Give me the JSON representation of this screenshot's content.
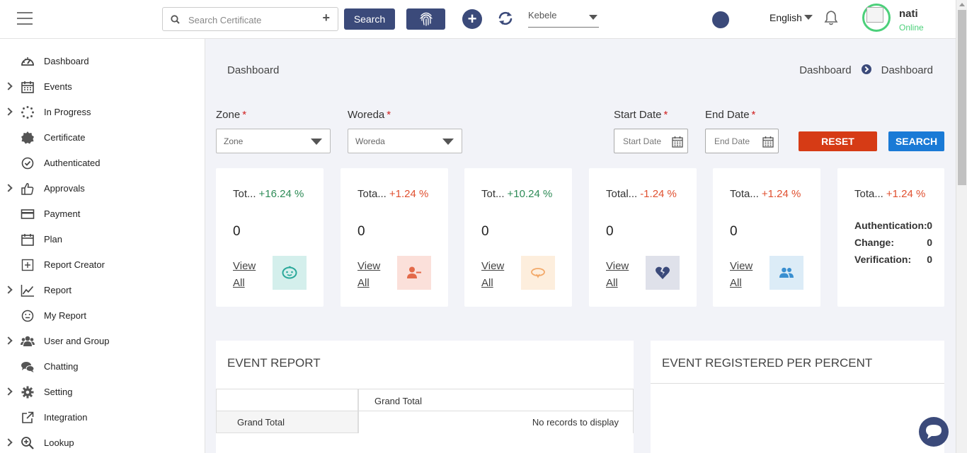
{
  "topbar": {
    "search_placeholder": "Search Certificate",
    "search_button": "Search",
    "kebele": "Kebele",
    "language": "English",
    "user": {
      "name": "nati",
      "status": "Online"
    }
  },
  "sidebar": {
    "items": [
      {
        "label": "Dashboard",
        "icon": "dashboard-gauge-icon",
        "expandable": false
      },
      {
        "label": "Events",
        "icon": "calendar-icon",
        "expandable": true
      },
      {
        "label": "In Progress",
        "icon": "spinner-icon",
        "expandable": true
      },
      {
        "label": "Certificate",
        "icon": "certificate-icon",
        "expandable": false
      },
      {
        "label": "Authenticated",
        "icon": "check-circle-icon",
        "expandable": false
      },
      {
        "label": "Approvals",
        "icon": "thumbs-up-icon",
        "expandable": true
      },
      {
        "label": "Payment",
        "icon": "credit-card-icon",
        "expandable": false
      },
      {
        "label": "Plan",
        "icon": "calendar-icon",
        "expandable": false
      },
      {
        "label": "Report Creator",
        "icon": "plus-square-icon",
        "expandable": false
      },
      {
        "label": "Report",
        "icon": "line-chart-icon",
        "expandable": true
      },
      {
        "label": "My Report",
        "icon": "smiley-icon",
        "expandable": false
      },
      {
        "label": "User and Group",
        "icon": "users-icon",
        "expandable": true
      },
      {
        "label": "Chatting",
        "icon": "chat-icon",
        "expandable": false
      },
      {
        "label": "Setting",
        "icon": "gear-icon",
        "expandable": true
      },
      {
        "label": "Integration",
        "icon": "external-link-icon",
        "expandable": false
      },
      {
        "label": "Lookup",
        "icon": "magnifier-plus-icon",
        "expandable": true
      }
    ]
  },
  "page": {
    "title": "Dashboard",
    "breadcrumb": [
      "Dashboard",
      "Dashboard"
    ]
  },
  "filters": {
    "zone_label": "Zone",
    "zone_value": "Zone",
    "woreda_label": "Woreda",
    "woreda_value": "Woreda",
    "start_label": "Start Date",
    "start_placeholder": "Start Date",
    "end_label": "End Date",
    "end_placeholder": "End Date",
    "required_mark": "*",
    "reset": "RESET",
    "search": "SEARCH"
  },
  "cards": [
    {
      "title": "Tot...",
      "pct": "+16.24 %",
      "trend": "up",
      "value": "0",
      "view": "View All",
      "icon": "baby-face-icon",
      "icon_bg": "#d4efec",
      "icon_color": "#2aa89a"
    },
    {
      "title": "Tota...",
      "pct": "+1.24 %",
      "trend": "down",
      "value": "0",
      "view": "View All",
      "icon": "user-minus-icon",
      "icon_bg": "#fbe0da",
      "icon_color": "#e36a4a"
    },
    {
      "title": "Tot...",
      "pct": "+10.24 %",
      "trend": "up",
      "value": "0",
      "view": "View All",
      "icon": "ring-icon",
      "icon_bg": "#fdeedd",
      "icon_color": "#f2a96a"
    },
    {
      "title": "Total...",
      "pct": "-1.24 %",
      "trend": "down",
      "value": "0",
      "view": "View All",
      "icon": "broken-heart-icon",
      "icon_bg": "#dfe1ea",
      "icon_color": "#3b4a7a"
    },
    {
      "title": "Tota...",
      "pct": "+1.24 %",
      "trend": "down",
      "value": "0",
      "view": "View All",
      "icon": "users-icon",
      "icon_bg": "#dcecf7",
      "icon_color": "#3a8fd0"
    }
  ],
  "stats_card": {
    "title": "Tota...",
    "pct": "+1.24 %",
    "rows": [
      {
        "label": "Authentication:",
        "value": "0"
      },
      {
        "label": "Change:",
        "value": "0"
      },
      {
        "label": "Verification:",
        "value": "0"
      }
    ]
  },
  "event_report": {
    "title": "EVENT REPORT",
    "header_col": "Grand Total",
    "row_label": "Grand Total",
    "empty_text": "No records to display"
  },
  "event_percent": {
    "title": "EVENT REGISTERED PER PERCENT"
  }
}
